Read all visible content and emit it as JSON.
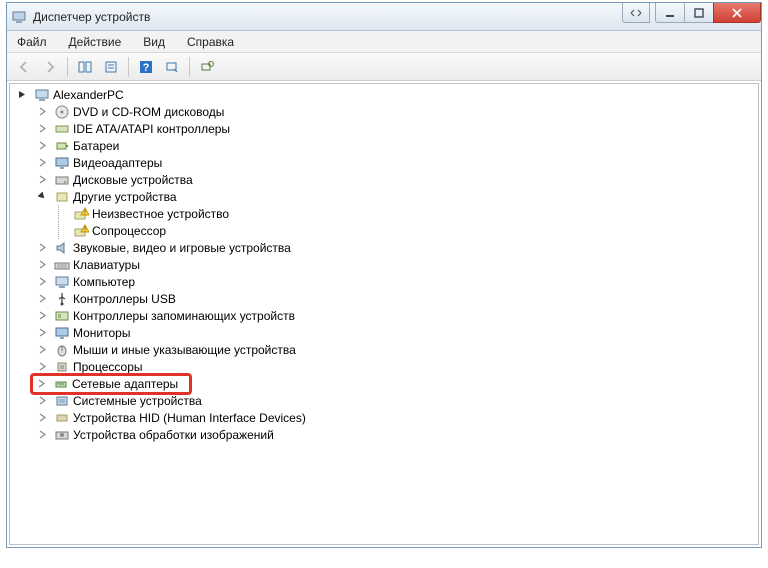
{
  "window": {
    "title": "Диспетчер устройств"
  },
  "menu": {
    "file": "Файл",
    "action": "Действие",
    "view": "Вид",
    "help": "Справка"
  },
  "tree": {
    "root": "AlexanderPC",
    "items": [
      {
        "label": "DVD и CD-ROM дисководы",
        "icon": "disc"
      },
      {
        "label": "IDE ATA/ATAPI контроллеры",
        "icon": "ide"
      },
      {
        "label": "Батареи",
        "icon": "battery"
      },
      {
        "label": "Видеоадаптеры",
        "icon": "display"
      },
      {
        "label": "Дисковые устройства",
        "icon": "disk"
      },
      {
        "label": "Другие устройства",
        "icon": "other",
        "expanded": true,
        "children": [
          {
            "label": "Неизвестное устройство",
            "icon": "warn"
          },
          {
            "label": "Сопроцессор",
            "icon": "warn"
          }
        ]
      },
      {
        "label": "Звуковые, видео и игровые устройства",
        "icon": "sound"
      },
      {
        "label": "Клавиатуры",
        "icon": "keyboard"
      },
      {
        "label": "Компьютер",
        "icon": "computer"
      },
      {
        "label": "Контроллеры USB",
        "icon": "usb"
      },
      {
        "label": "Контроллеры запоминающих устройств",
        "icon": "storage"
      },
      {
        "label": "Мониторы",
        "icon": "monitor"
      },
      {
        "label": "Мыши и иные указывающие устройства",
        "icon": "mouse"
      },
      {
        "label": "Процессоры",
        "icon": "cpu"
      },
      {
        "label": "Сетевые адаптеры",
        "icon": "network",
        "highlighted": true
      },
      {
        "label": "Системные устройства",
        "icon": "system"
      },
      {
        "label": "Устройства HID (Human Interface Devices)",
        "icon": "hid"
      },
      {
        "label": "Устройства обработки изображений",
        "icon": "imaging"
      }
    ]
  }
}
